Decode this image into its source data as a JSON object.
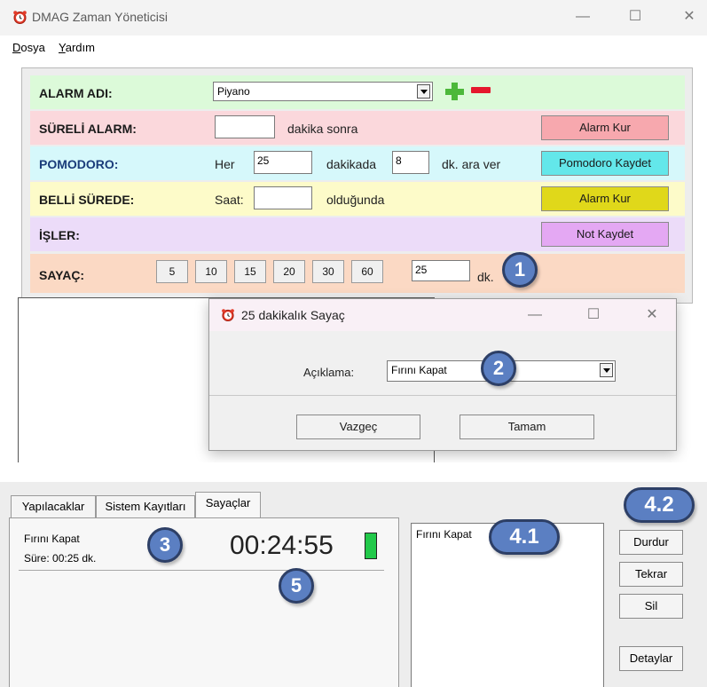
{
  "window": {
    "title": "DMAG Zaman Yöneticisi",
    "controls": {
      "minimize": "—",
      "maximize": "☐",
      "close": "✕"
    }
  },
  "menu": [
    {
      "access": "D",
      "rest": "osya"
    },
    {
      "access": "Y",
      "rest": "ardım"
    }
  ],
  "alarm_name": {
    "label": "ALARM ADI:",
    "value": "Piyano",
    "color": "#dcfad9"
  },
  "timed_alarm": {
    "label": "SÜRELİ ALARM:",
    "value": "",
    "suffix": "dakika sonra",
    "button": "Alarm Kur",
    "color": "#fbd8dc",
    "button_color": "#f7a8ae"
  },
  "pomodoro": {
    "label": "POMODORO:",
    "prefix": "Her",
    "work_minutes": "25",
    "middle": "dakikada",
    "break_minutes": "8",
    "suffix": "dk. ara ver",
    "button": "Pomodoro Kaydet",
    "color": "#d6f8fb",
    "button_color": "#63e7ea"
  },
  "specific_time": {
    "label": "BELLİ SÜREDE:",
    "prefix": "Saat:",
    "value": "",
    "suffix": "olduğunda",
    "button": "Alarm Kur",
    "color": "#fdfbc9",
    "button_color": "#e0d81a"
  },
  "tasks": {
    "label": "İŞLER:",
    "button": "Not Kaydet",
    "color": "#ecdcf9",
    "button_color": "#e4a8f3"
  },
  "counter": {
    "label": "SAYAÇ:",
    "presets": [
      "5",
      "10",
      "15",
      "20",
      "30",
      "60"
    ],
    "value": "25",
    "suffix": "dk.",
    "color": "#fbd9c4"
  },
  "dialog": {
    "title": "25 dakikalık Sayaç",
    "desc_label": "Açıklama:",
    "desc_value": "Fırını Kapat",
    "cancel": "Vazgeç",
    "ok": "Tamam"
  },
  "tabs": [
    {
      "label": "Yapılacaklar",
      "active": false
    },
    {
      "label": "Sistem Kayıtları",
      "active": false
    },
    {
      "label": "Sayaçlar",
      "active": true
    }
  ],
  "timer_entry": {
    "name": "Fırını Kapat",
    "duration": "Süre: 00:25 dk.",
    "time": "00:24:55",
    "indicator_color": "#22c94a"
  },
  "timer_list": [
    "Fırını Kapat"
  ],
  "actions": {
    "stop": "Durdur",
    "repeat": "Tekrar",
    "delete": "Sil",
    "details": "Detaylar"
  },
  "callouts": {
    "c1": "1",
    "c2": "2",
    "c3": "3",
    "c41": "4.1",
    "c42": "4.2",
    "c5": "5"
  },
  "icons": {
    "app": "alarm-clock-icon",
    "add": "plus-icon",
    "remove": "minus-icon",
    "dropdown": "chevron-down-icon"
  }
}
